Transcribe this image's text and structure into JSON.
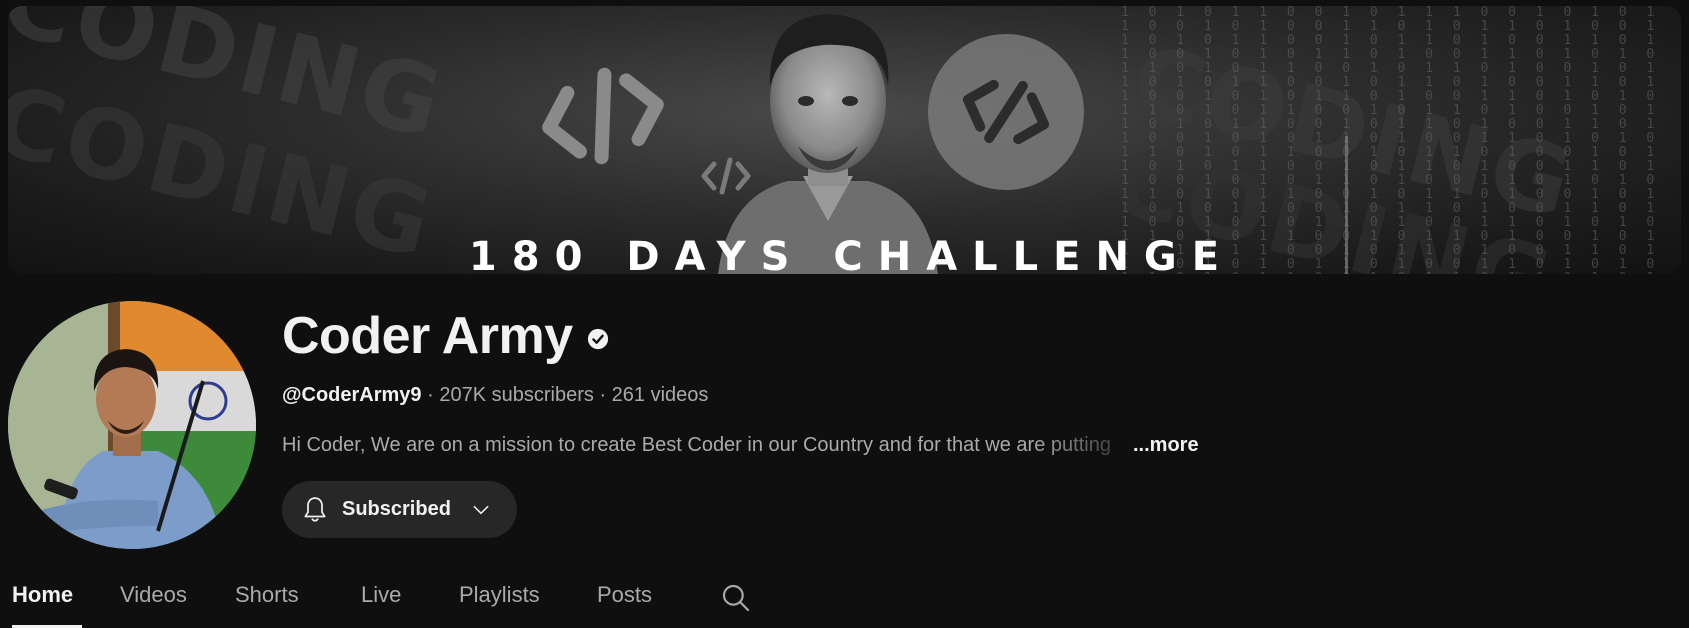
{
  "banner": {
    "title": "180 DAYS CHALLENGE",
    "background_words": [
      "CODING",
      "CODING",
      "CODING",
      "CODING"
    ]
  },
  "channel": {
    "name": "Coder Army",
    "handle": "@CoderArmy9",
    "subscribers": "207K subscribers",
    "videos": "261 videos",
    "separator": "·",
    "description": "Hi Coder, We are on a mission to create Best Coder in our Country and for that we are putting",
    "more_label": "...more",
    "verified_icon": "verified-check-icon"
  },
  "subscribe": {
    "label": "Subscribed",
    "bell_icon": "bell-icon",
    "chevron_icon": "chevron-down-icon"
  },
  "tabs": [
    {
      "label": "Home",
      "active": true
    },
    {
      "label": "Videos",
      "active": false
    },
    {
      "label": "Shorts",
      "active": false
    },
    {
      "label": "Live",
      "active": false
    },
    {
      "label": "Playlists",
      "active": false
    },
    {
      "label": "Posts",
      "active": false
    }
  ],
  "colors": {
    "background": "#0f0f0f",
    "text_primary": "#f1f1f1",
    "text_secondary": "#aaaaaa",
    "button_bg": "#272727"
  }
}
